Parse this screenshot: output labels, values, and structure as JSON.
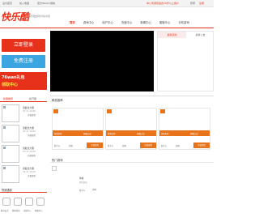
{
  "topbar": {
    "links": [
      "设为首页",
      "加入收藏",
      "官方Weixin微信"
    ],
    "right_note": "本公司游戏适合18岁以上用户",
    "login": "登录",
    "register": "注册"
  },
  "header": {
    "logo": "快乐酷",
    "slogan": "快乐酷游戏尽情享受"
  },
  "nav": {
    "items": [
      "首页",
      "游戏中心",
      "用户中心",
      "充值中心",
      "新闻中心",
      "客服中心",
      "手机游戏"
    ]
  },
  "left": {
    "login_label": "立即登录",
    "register_label": "免费注册",
    "banner_line1": "76wan礼包",
    "banner_line2": "领取中心",
    "tabs": [
      "新服推荐",
      "新开服"
    ],
    "servers": [
      {
        "name": "双截龙大服",
        "date": "03-11 10:00",
        "action": "开始游戏"
      },
      {
        "name": "双截龙大服",
        "date": "03-11 10:00",
        "action": "开始游戏"
      },
      {
        "name": "双截龙大服",
        "date": "03-11 10:00",
        "action": "开始游戏"
      },
      {
        "name": "双截龙大服",
        "date": "03-11 10:00",
        "action": "开始游戏"
      }
    ],
    "quick_title": "快速通道",
    "quick_items": [
      "帐号安全",
      "密码找回",
      "充值中心",
      "客服中心"
    ]
  },
  "notice": {
    "tabs": [
      "最新活动",
      "最新公告"
    ]
  },
  "games": {
    "title": "精品推荐",
    "cards": [
      {
        "strip_left": "游戏名称",
        "strip_right": "神魔之战",
        "links": [
          "新手卡",
          "官网"
        ],
        "play": "开始游戏"
      },
      {
        "strip_left": "游戏名称",
        "strip_right": "神魔之战",
        "links": [
          "新手卡",
          "官网"
        ],
        "play": "开始游戏"
      },
      {
        "strip_left": "游戏名称",
        "strip_right": "神魔之战",
        "links": [
          "新手卡",
          "官网"
        ],
        "play": "开始游戏"
      }
    ]
  },
  "hot": {
    "title": "热门游戏",
    "item": {
      "name": "神曲",
      "date": "角色扮演",
      "card": "新手卡",
      "site": "官网"
    }
  },
  "colors": {
    "accent": "#e8311a",
    "register": "#3aa5e0",
    "card_strip": "#e8731a"
  }
}
